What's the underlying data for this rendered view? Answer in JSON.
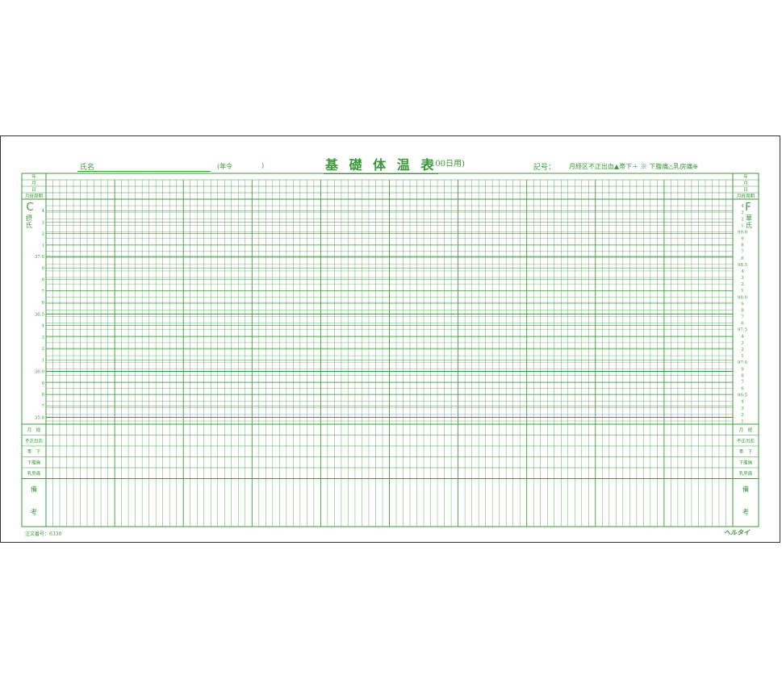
{
  "form": {
    "title": "基 礎 体 温 表",
    "subtitle": "(100日用)",
    "name_label": "氏名",
    "age_label": "(年令",
    "age_close": ")",
    "symbols_label": "記号：",
    "symbols_text": "月経区不正出血▲帯下＋ ※ 下腹痛△乳房痛⊕",
    "order_number": "注文番号：6330",
    "brand": "ヘルタイ"
  },
  "header_rows": [
    "年",
    "月",
    "日",
    "月経周期"
  ],
  "celsius": {
    "unit_letter": "C",
    "unit_name": "摂氏",
    "ticks": [
      "4",
      "3",
      "2",
      "1",
      "37.0",
      "9",
      "8",
      "7",
      "6",
      "36.5",
      "4",
      "3",
      "2",
      "1",
      "36.0",
      "9",
      "8",
      "7",
      "35.8"
    ]
  },
  "fahrenheit": {
    "unit_letter": "F",
    "unit_name": "華氏",
    "ticks": [
      "4",
      "3",
      "2",
      "1",
      "99.0",
      "9",
      "8",
      "7",
      "6",
      "98.5",
      "4",
      "3",
      "2",
      "1",
      "98.0",
      "9",
      "8",
      "7",
      "6",
      "97.5",
      "4",
      "3",
      "2",
      "1",
      "97.0",
      "9",
      "8",
      "7",
      "6",
      "96.5",
      "4",
      "3",
      "2",
      "1"
    ]
  },
  "bottom_rows": [
    "月　経",
    "不正出血",
    "帯　下",
    "下腹痛",
    "乳房痛"
  ],
  "remarks": [
    "備",
    "考"
  ],
  "day_columns": 100,
  "colors": {
    "ink": "#3a9a3a",
    "border": "#333333"
  }
}
